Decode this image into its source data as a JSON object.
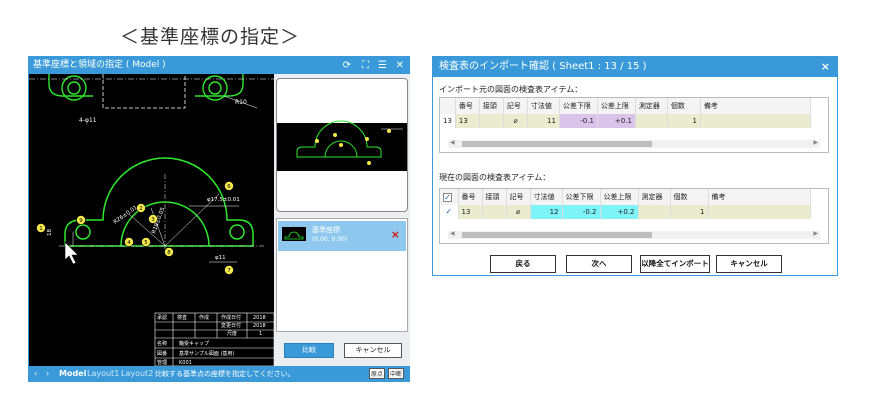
{
  "heading": "＜基準座標の指定＞",
  "left_window": {
    "title": "基準座標と領域の指定 ( Model )",
    "icons": [
      "refresh-icon",
      "fit-icon",
      "menu-icon",
      "close-icon"
    ],
    "drawing_labels": {
      "r10": "R10",
      "four_phi11": "4-φ11",
      "phi17": "φ17.5±0.01",
      "r26": "R26±0.01",
      "r27": "R26",
      "r18": "R18±0.05",
      "phi11": "φ11",
      "dim_18": "18",
      "balloons": [
        "1",
        "2",
        "3",
        "4",
        "5",
        "6",
        "7",
        "8",
        "9"
      ]
    },
    "title_block": {
      "headers": [
        "承認",
        "検査",
        "作成",
        "作成日付",
        "2018"
      ],
      "row2": [
        "",
        "",
        "",
        "変更日付",
        "2018"
      ],
      "row3": [
        "",
        "",
        "",
        "尺度",
        "1"
      ],
      "name_label": "名称",
      "name_value": "軸受キャップ",
      "file_label": "図番",
      "file_value": "基準サンプル図面 (基用)",
      "bottom_label": "管理",
      "bottom_value": "K001"
    },
    "list_item": {
      "label": "基準座標",
      "coords": "(0.00, 0.00)",
      "delete": "×"
    },
    "compare_button": "比較",
    "cancel_button": "キャンセル",
    "status": {
      "tabs": [
        "Model",
        "Layout1",
        "Layout2"
      ],
      "message": "比較する基準点の座標を指定してください。",
      "origin_button": "原点",
      "stop_button": "中断"
    }
  },
  "dialog": {
    "title": "検査表のインポート確認 ( Sheet1 : 13 / 15 )",
    "close": "×",
    "source_label": "インポート元の図面の検査表アイテム：",
    "current_label": "現在の図面の検査表アイテム：",
    "columns": [
      "番号",
      "接頭",
      "記号",
      "寸法値",
      "公差下限",
      "公差上限",
      "測定器",
      "個数",
      "備考"
    ],
    "source_rows": [
      {
        "row_header": "13",
        "cells": [
          "13",
          "",
          "⌀",
          "11",
          "-0.1",
          "+0.1",
          "",
          "1",
          ""
        ]
      }
    ],
    "current_rows": [
      {
        "checked": "✓",
        "cells": [
          "13",
          "",
          "⌀",
          "12",
          "-0.2",
          "+0.2",
          "",
          "1",
          ""
        ]
      }
    ],
    "buttons": {
      "back": "戻る",
      "next": "次へ",
      "import_all": "以降全てインポート",
      "cancel": "キャンセル"
    }
  }
}
